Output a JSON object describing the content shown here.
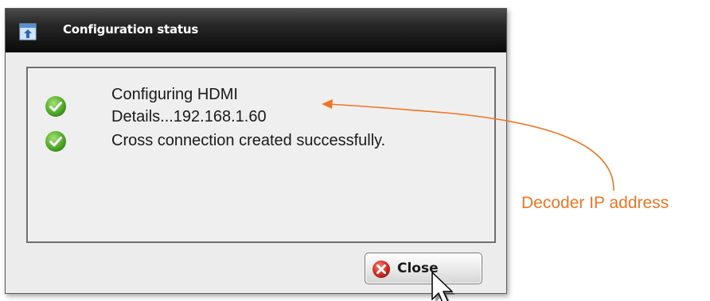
{
  "window": {
    "title": "Configuration status",
    "title_icon": "upload-window-icon"
  },
  "status": {
    "items": [
      {
        "icon": "check-circle-icon",
        "line1": "Configuring HDMI",
        "line2": "Details...192.168.1.60"
      },
      {
        "icon": "check-circle-icon",
        "line1": "Cross connection created successfully."
      }
    ]
  },
  "buttons": {
    "close_label": "Close",
    "close_icon": "close-circle-icon"
  },
  "annotation": {
    "label": "Decoder IP address",
    "color": "#f07522"
  },
  "colors": {
    "title_bar": "#1a1a1a",
    "check_green": "#5cb531",
    "close_red": "#d9342b"
  }
}
